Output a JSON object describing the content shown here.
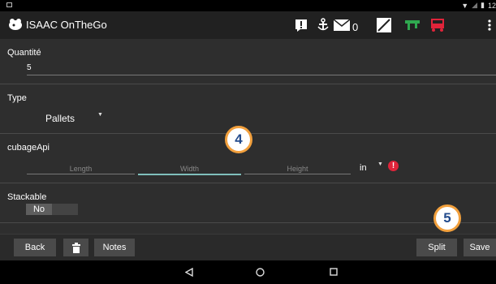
{
  "status_bar": {
    "time": "12"
  },
  "app_bar": {
    "title": "ISAAC OnTheGo",
    "message_count": "0"
  },
  "form": {
    "quantity": {
      "label": "Quantité",
      "value": "5"
    },
    "type": {
      "label": "Type",
      "value": "Pallets"
    },
    "cubage": {
      "label": "cubageApi",
      "length_placeholder": "Length",
      "width_placeholder": "Width",
      "height_placeholder": "Height",
      "unit": "in"
    },
    "stackable": {
      "label": "Stackable",
      "value": "No"
    }
  },
  "callouts": {
    "first": "4",
    "second": "5"
  },
  "bottom_bar": {
    "back_label": "Back",
    "notes_label": "Notes",
    "split_label": "Split",
    "save_label": "Save"
  },
  "colors": {
    "accent": "#7fbfbb",
    "error": "#e0243a",
    "callout_border": "#f2a03d",
    "callout_text": "#234b8c"
  }
}
